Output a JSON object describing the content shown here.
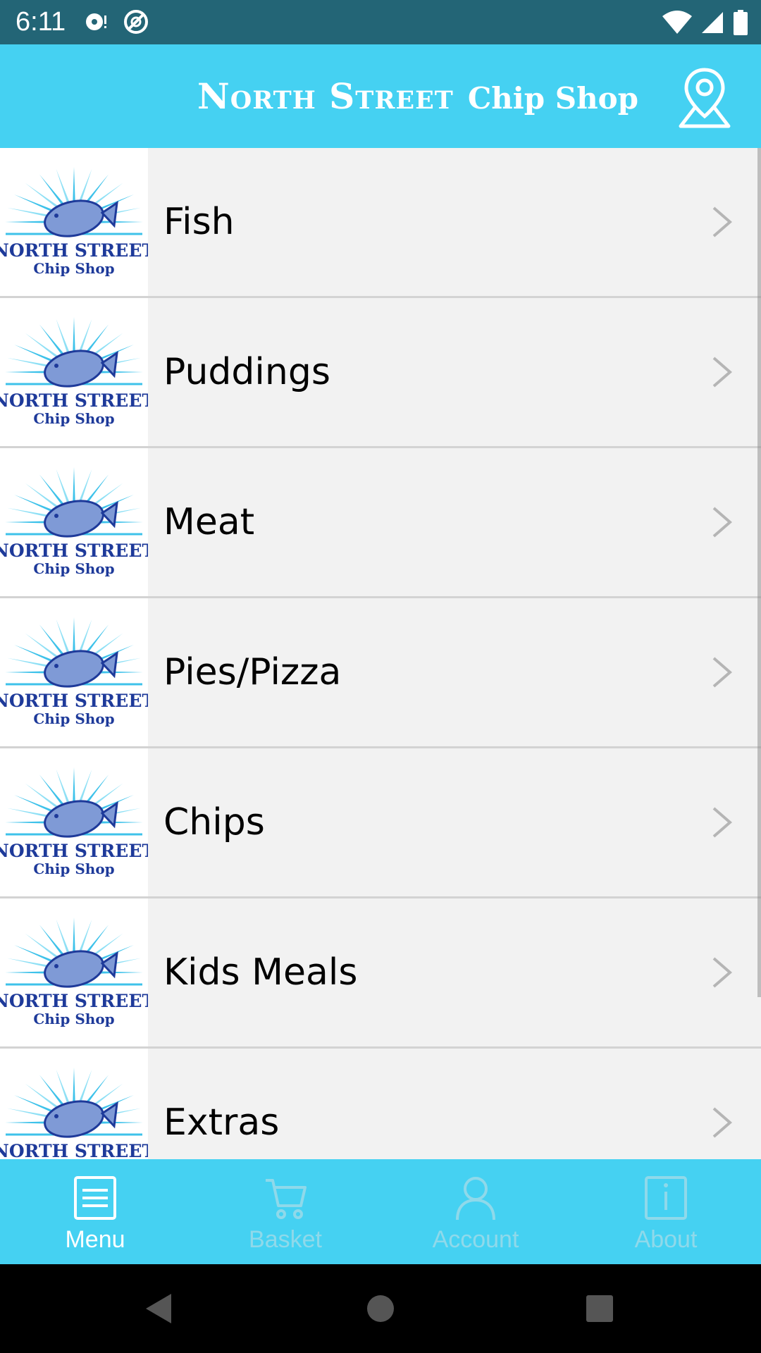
{
  "status_bar": {
    "time": "6:11",
    "icons_left": [
      "notification-icon",
      "sync-icon"
    ],
    "icons_right": [
      "wifi-icon",
      "cell-signal-icon",
      "battery-icon"
    ]
  },
  "header": {
    "brand_main": "North Street",
    "brand_sub": "Chip Shop",
    "location_icon": "map-pin-icon"
  },
  "menu": {
    "logo_text_line1": "NORTH STREET",
    "logo_text_line2": "Chip Shop",
    "items": [
      {
        "label": "Fish"
      },
      {
        "label": "Puddings"
      },
      {
        "label": "Meat"
      },
      {
        "label": "Pies/Pizza"
      },
      {
        "label": "Chips"
      },
      {
        "label": "Kids Meals"
      },
      {
        "label": "Extras"
      }
    ]
  },
  "bottom_nav": {
    "items": [
      {
        "label": "Menu",
        "icon": "menu-list-icon",
        "active": true
      },
      {
        "label": "Basket",
        "icon": "cart-icon",
        "active": false
      },
      {
        "label": "Account",
        "icon": "user-icon",
        "active": false
      },
      {
        "label": "About",
        "icon": "info-icon",
        "active": false
      }
    ]
  },
  "colors": {
    "status_bar": "#236576",
    "header": "#45d1f2",
    "list_bg": "#f2f2f2",
    "logo_blue": "#1e3a9a",
    "logo_cyan": "#3ec2ea"
  }
}
